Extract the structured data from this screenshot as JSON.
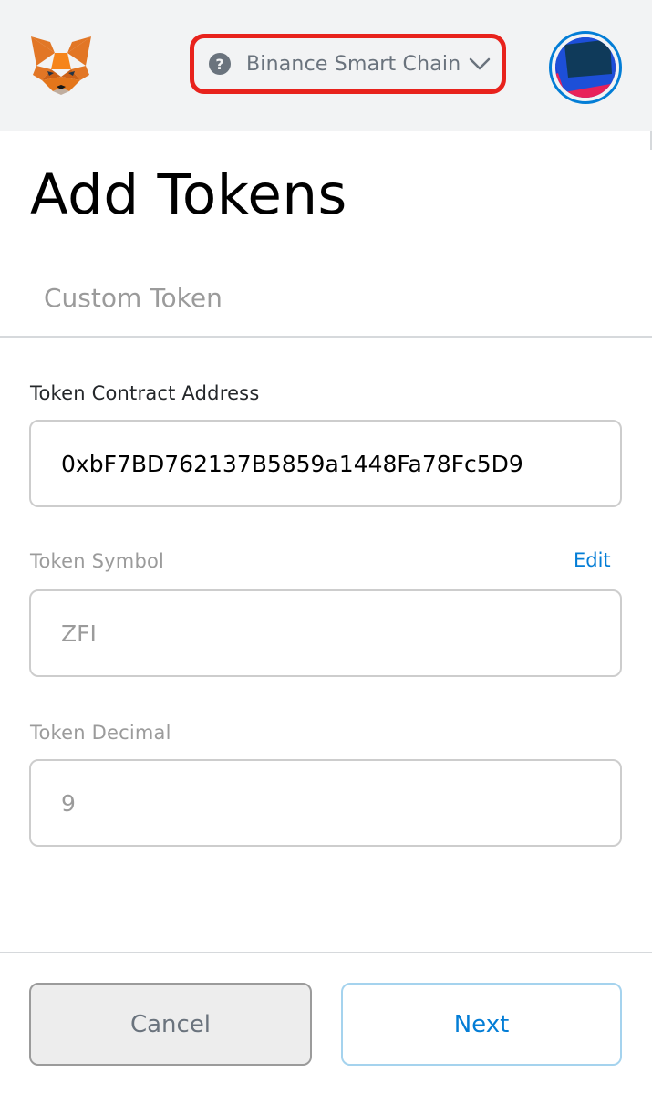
{
  "header": {
    "network_label": "Binance Smart Chain",
    "help_symbol": "?",
    "logo_icon": "fox-icon",
    "chevron_icon": "chevron-down-icon"
  },
  "page": {
    "title": "Add Tokens",
    "tab": "Custom Token"
  },
  "form": {
    "address_label": "Token Contract Address",
    "address_value": "0xbF7BD762137B5859a1448Fa78Fc5D9",
    "symbol_label": "Token Symbol",
    "edit_link": "Edit",
    "symbol_value": "ZFI",
    "decimal_label": "Token Decimal",
    "decimal_value": "9"
  },
  "footer": {
    "cancel_label": "Cancel",
    "next_label": "Next"
  },
  "colors": {
    "header_bg": "#f2f3f4",
    "highlight_border": "#e8221c",
    "accent": "#037dd6",
    "muted_text": "#9b9b9b"
  }
}
